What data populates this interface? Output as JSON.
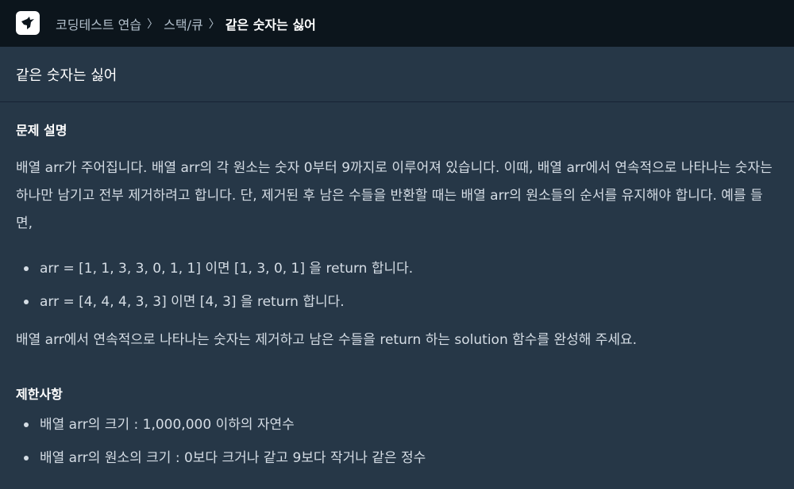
{
  "header": {
    "logo_icon": "programmers-bird-logo",
    "breadcrumb": [
      "코딩테스트 연습",
      "스택/큐",
      "같은 숫자는 싫어"
    ],
    "separator": "〉"
  },
  "problem": {
    "title": "같은 숫자는 싫어",
    "description_heading": "문제 설명",
    "description_paragraphs": [
      "배열 arr가 주어집니다. 배열 arr의 각 원소는 숫자 0부터 9까지로 이루어져 있습니다. 이때, 배열 arr에서 연속적으로 나타나는 숫자는 하나만 남기고 전부 제거하려고 합니다. 단, 제거된 후 남은 수들을 반환할 때는 배열 arr의 원소들의 순서를 유지해야 합니다. 예를 들면,",
      "배열 arr에서 연속적으로 나타나는 숫자는 제거하고 남은 수들을 return 하는 solution 함수를 완성해 주세요."
    ],
    "examples": [
      "arr = [1, 1, 3, 3, 0, 1, 1] 이면 [1, 3, 0, 1] 을 return 합니다.",
      "arr = [4, 4, 4, 3, 3] 이면 [4, 3] 을 return 합니다."
    ],
    "constraints_heading": "제한사항",
    "constraints": [
      "배열 arr의 크기 : 1,000,000 이하의 자연수",
      "배열 arr의 원소의 크기 : 0보다 크거나 같고 9보다 작거나 같은 정수"
    ]
  },
  "colors": {
    "topbar_bg": "#0c151c",
    "content_bg": "#263747",
    "text": "#d5dde5",
    "heading": "#ffffff"
  }
}
